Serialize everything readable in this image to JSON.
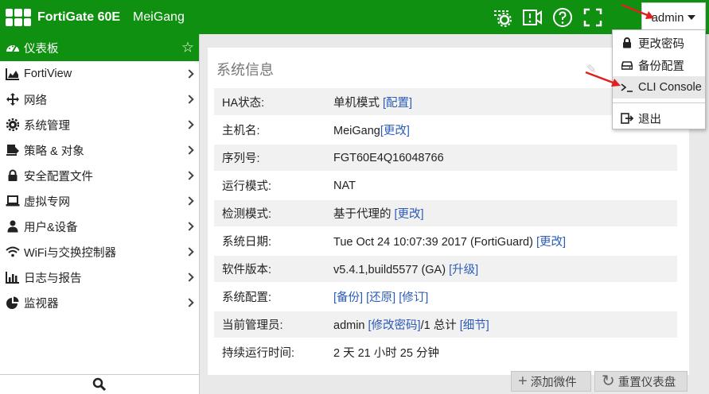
{
  "topbar": {
    "brand": "FortiGate 60E",
    "hostname": "MeiGang",
    "user": "admin"
  },
  "sidebar": {
    "items": [
      {
        "label": "仪表板",
        "icon": "dashboard-icon"
      },
      {
        "label": "FortiView",
        "icon": "fortiview-chart-icon"
      },
      {
        "label": "网络",
        "icon": "network-move-icon"
      },
      {
        "label": "系统管理",
        "icon": "gear-icon"
      },
      {
        "label": "策略 & 对象",
        "icon": "policy-stamp-icon"
      },
      {
        "label": "安全配置文件",
        "icon": "lock-icon"
      },
      {
        "label": "虚拟专网",
        "icon": "laptop-icon"
      },
      {
        "label": "用户&设备",
        "icon": "user-icon"
      },
      {
        "label": "WiFi与交换控制器",
        "icon": "wifi-icon"
      },
      {
        "label": "日志与报告",
        "icon": "bar-chart-icon"
      },
      {
        "label": "监视器",
        "icon": "pie-chart-icon"
      }
    ]
  },
  "panel": {
    "title": "系统信息",
    "rows": [
      {
        "key": "HA状态:",
        "value": "单机模式",
        "links": [
          "[配置]"
        ]
      },
      {
        "key": "主机名:",
        "value": "MeiGang",
        "links": [
          "[更改]"
        ]
      },
      {
        "key": "序列号:",
        "value": "FGT60E4Q16048766",
        "links": []
      },
      {
        "key": "运行模式:",
        "value": "NAT",
        "links": []
      },
      {
        "key": "检测模式:",
        "value": "基于代理的",
        "links": [
          "[更改]"
        ]
      },
      {
        "key": "系统日期:",
        "value": "Tue Oct 24 10:07:39 2017 (FortiGuard)",
        "links": [
          "[更改]"
        ]
      },
      {
        "key": "软件版本:",
        "value": "v5.4.1,build5577 (GA)",
        "links": [
          "[升级]"
        ]
      },
      {
        "key": "系统配置:",
        "value": "",
        "links": [
          "[备份]",
          "[还原]",
          "[修订]"
        ]
      },
      {
        "key": "当前管理员:",
        "value": "admin",
        "links": [
          "[修改密码]"
        ],
        "suffix": "/1 总计",
        "links2": [
          "[细节]"
        ]
      },
      {
        "key": "持续运行时间:",
        "value": "2 天 21 小时 25 分钟",
        "links": []
      }
    ]
  },
  "buttons": {
    "add_widget": "添加微件",
    "reset_dashboard": "重置仪表盘"
  },
  "dropdown": {
    "items": [
      {
        "label": "更改密码",
        "icon": "lock-icon"
      },
      {
        "label": "备份配置",
        "icon": "hard-drive-icon"
      },
      {
        "label": "CLI Console",
        "icon": "terminal-icon"
      },
      {
        "label": "退出",
        "icon": "logout-icon"
      }
    ]
  },
  "colors": {
    "brand_green": "#109010",
    "link_blue": "#2a5bb8",
    "annotation_red": "#e02020"
  }
}
